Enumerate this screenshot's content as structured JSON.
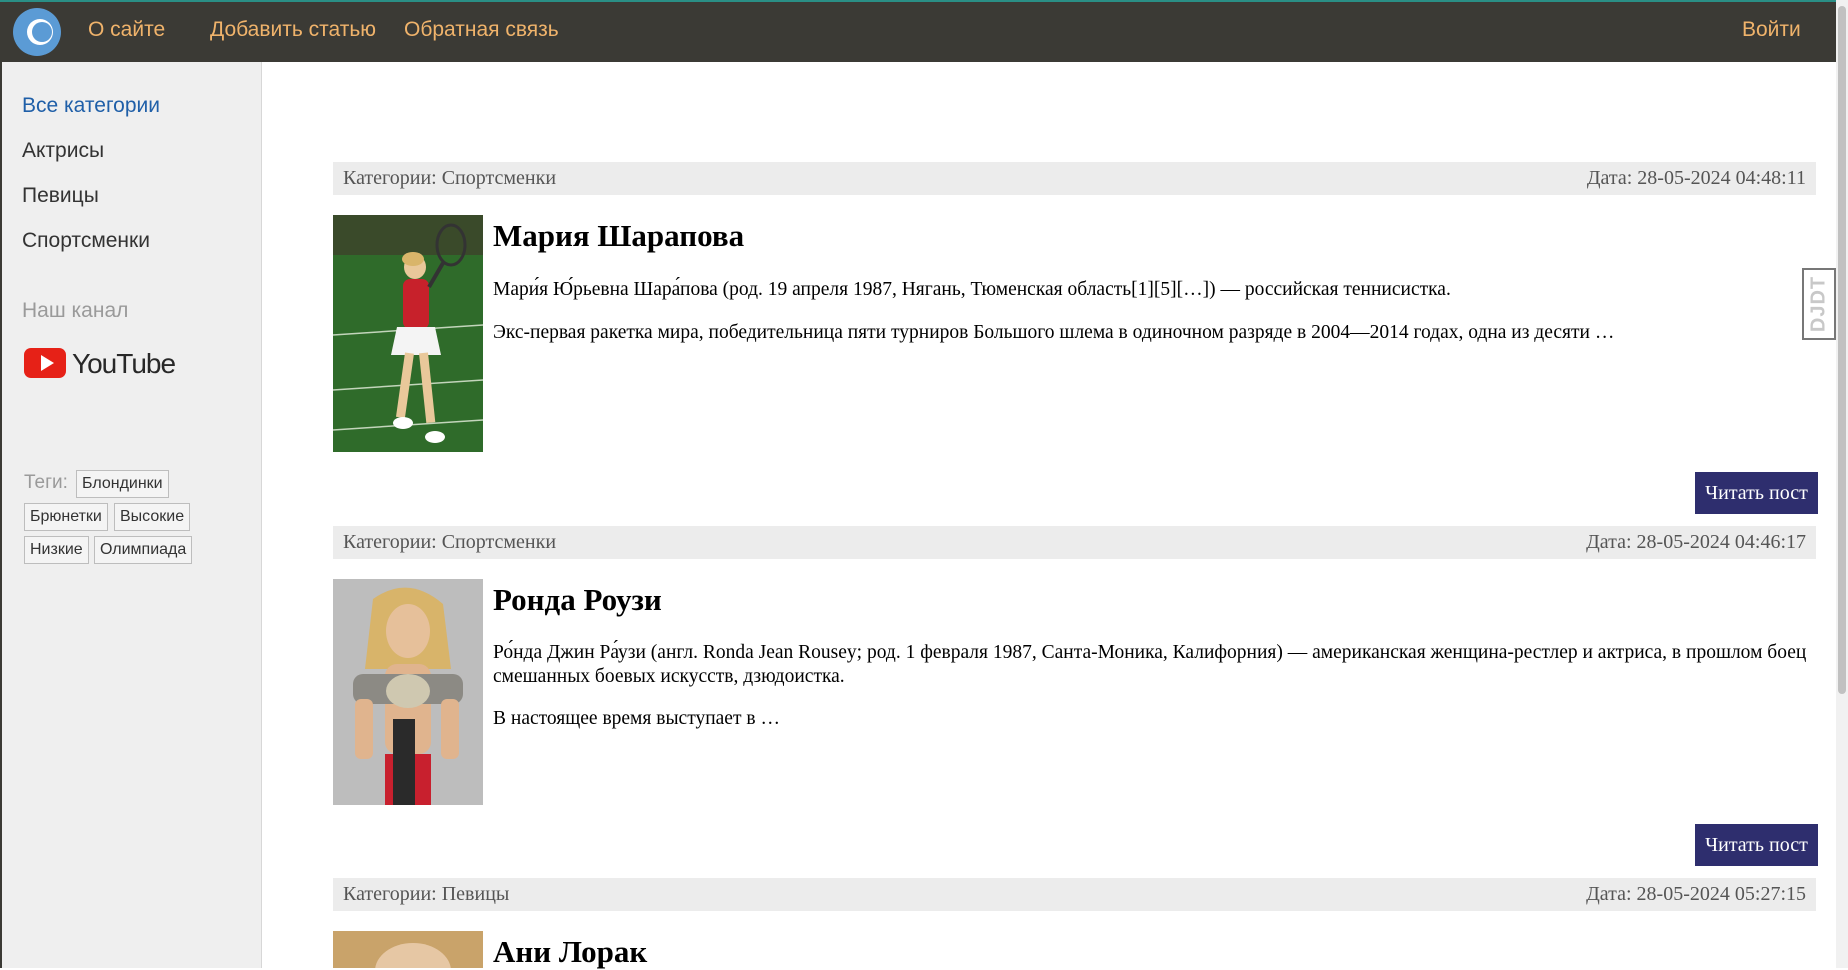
{
  "nav": {
    "links": [
      "О сайте",
      "Добавить статью",
      "Обратная связь"
    ],
    "login": "Войти"
  },
  "sidebar": {
    "categories": [
      "Все категории",
      "Актрисы",
      "Певицы",
      "Спортсменки"
    ],
    "channel_label": "Наш канал",
    "youtube_text": "YouTube",
    "tags_label": "Теги:",
    "tags": [
      "Блондинки",
      "Брюнетки",
      "Высокие",
      "Низкие",
      "Олимпиада"
    ]
  },
  "posts": [
    {
      "category": "Категории: Спортсменки",
      "date": "Дата: 28-05-2024 04:48:11",
      "title": "Мария Шарапова",
      "p1": "Мари́я Ю́рьевна Шара́пова (род. 19 апреля 1987, Нягань, Тюменская область[1][5][…]) — российская теннисистка.",
      "p2": "Экс-первая ракетка мира, победительница пяти турниров Большого шлема в одиночном разряде в 2004—2014 годах, одна из десяти …",
      "read_label": "Читать пост"
    },
    {
      "category": "Категории: Спортсменки",
      "date": "Дата: 28-05-2024 04:46:17",
      "title": "Ронда Роузи",
      "p1": "Ро́нда Джин Ра́узи (англ. Ronda Jean Rousey; род. 1 февраля 1987, Санта-Моника, Калифорния) — американская женщина-рестлер и актриса, в прошлом боец смешанных боевых искусств, дзюдоистка.",
      "p2": "В настоящее время выступает в …",
      "read_label": "Читать пост"
    },
    {
      "category": "Категории: Певицы",
      "date": "Дата: 28-05-2024 05:27:15",
      "title": "Ани Лорак"
    }
  ],
  "djdt": "DJDT",
  "colors": {
    "topbar": "#3b3a35",
    "nav_link": "#f0b36b",
    "button": "#2e2e6e",
    "active_category": "#1f5fa8"
  }
}
